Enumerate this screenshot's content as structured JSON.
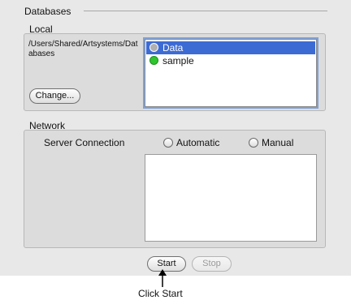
{
  "databases_section": {
    "title": "Databases"
  },
  "local": {
    "label": "Local",
    "path": "/Users/Shared/Artsystems/Databases",
    "change_button": "Change...",
    "databases": [
      {
        "name": "Data",
        "status_color": "#b0b0b0",
        "selected": true
      },
      {
        "name": "sample",
        "status_color": "#2ec62e",
        "selected": false
      }
    ]
  },
  "network": {
    "label": "Network",
    "server_connection_label": "Server Connection",
    "options": [
      {
        "label": "Automatic",
        "selected": false
      },
      {
        "label": "Manual",
        "selected": false
      }
    ]
  },
  "actions": {
    "start": "Start",
    "stop": "Stop"
  },
  "annotation": {
    "caption": "Click Start"
  },
  "colors": {
    "selection": "#3d6bd4",
    "panel_bg": "#e8e8e8",
    "group_bg": "#dcdcdc"
  }
}
